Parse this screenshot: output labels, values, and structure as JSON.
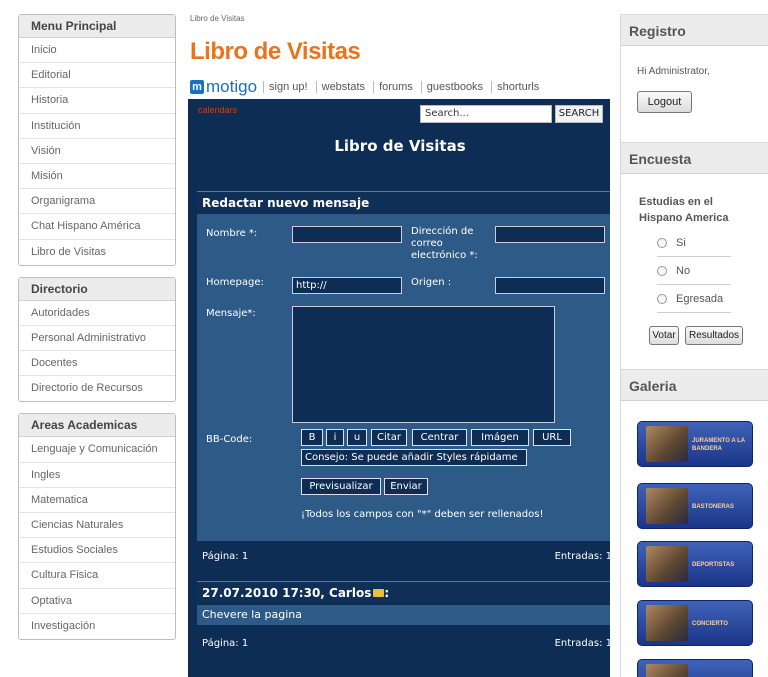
{
  "left_menu": [
    {
      "title": "Menu Principal",
      "items": [
        "Inicio",
        "Editorial",
        "Historia",
        "Institución",
        "Visión",
        "Misión",
        "Organigrama",
        "Chat Hispano América",
        "Libro de Visitas"
      ]
    },
    {
      "title": "Directorio",
      "items": [
        "Autoridades",
        "Personal Administrativo",
        "Docentes",
        "Directorio de Recursos"
      ]
    },
    {
      "title": "Areas Academicas",
      "items": [
        "Lenguaje y Comunicación",
        "Ingles",
        "Matematica",
        "Ciencias Naturales",
        "Estudios Sociales",
        "Cultura Fisica",
        "Optativa",
        "Investigación"
      ]
    }
  ],
  "main": {
    "breadcrumb": "Libro de Visitas",
    "title": "Libro de Visitas",
    "motigo": {
      "logo": "motigo",
      "links": [
        "sign up!",
        "webstats",
        "forums",
        "guestbooks",
        "shorturls"
      ]
    },
    "guestbook": {
      "top_link": "calendars",
      "search_placeholder": "Search...",
      "search_button": "SEARCH",
      "title": "Libro de Visitas",
      "form": {
        "header": "Redactar nuevo mensaje",
        "nombre_label": "Nombre *:",
        "email_label_1": "Dirección de",
        "email_label_2": "correo",
        "email_label_3": "electrónico *:",
        "homepage_label": "Homepage:",
        "homepage_value": "http://",
        "origen_label": "Origen :",
        "mensaje_label": "Mensaje*:",
        "bbcode_label": "BB-Code:",
        "bb_buttons": [
          "B",
          "i",
          "u",
          "Citar",
          "Centrar",
          "Imágen",
          "URL"
        ],
        "tip": "Consejo: Se puede añadir Styles rápidame",
        "preview_button": "Previsualizar",
        "send_button": "Enviar",
        "required_note": "¡Todos los campos con \"*\" deben ser rellenados!"
      },
      "pager_top": {
        "page": "Página: 1",
        "entries": "Entradas: 1"
      },
      "entry": {
        "header": "27.07.2010 17:30, Carlos",
        "colon": ":",
        "message": "Chevere la pagina"
      },
      "pager_bottom": {
        "page": "Página: 1",
        "entries": "Entradas: 1"
      }
    }
  },
  "right": {
    "registro": {
      "title": "Registro",
      "greeting": "Hi Administrator,",
      "logout": "Logout"
    },
    "encuesta": {
      "title": "Encuesta",
      "question": "Estudias en el Hispano America",
      "options": [
        "Si",
        "No",
        "Egresada"
      ],
      "vote_button": "Votar",
      "results_button": "Resultados"
    },
    "galeria": {
      "title": "Galeria",
      "items": [
        "JURAMENTO A LA BANDERA",
        "BASTONERAS",
        "DEPORTISTAS",
        "CONCIERTO",
        ""
      ]
    }
  }
}
